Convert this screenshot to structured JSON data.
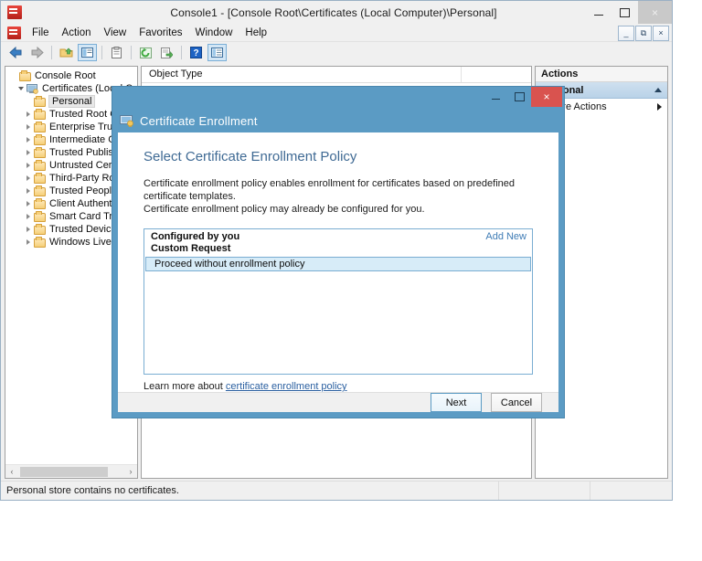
{
  "window": {
    "title": "Console1 - [Console Root\\Certificates (Local Computer)\\Personal]",
    "app_icon": "certificate-console-icon",
    "caption": {
      "minimize": "–",
      "maximize": "□",
      "close": "×"
    },
    "doc_caption": {
      "minimize": "_",
      "restore": "⧉",
      "close": "×"
    }
  },
  "menu": {
    "icon": "console-icon",
    "items": [
      {
        "label": "File"
      },
      {
        "label": "Action"
      },
      {
        "label": "View"
      },
      {
        "label": "Favorites"
      },
      {
        "label": "Window"
      },
      {
        "label": "Help"
      }
    ]
  },
  "toolbar": {
    "buttons": [
      {
        "name": "back-icon",
        "glyph": "◄"
      },
      {
        "name": "forward-icon",
        "glyph": "►"
      },
      {
        "name": "up-one-level-icon",
        "glyph": "▲"
      },
      {
        "name": "show-hide-console-tree-icon",
        "glyph": "▤",
        "pressed": true
      },
      {
        "name": "properties-icon",
        "glyph": "▯"
      },
      {
        "name": "refresh-icon",
        "glyph": "↻"
      },
      {
        "name": "export-list-icon",
        "glyph": "⇨"
      },
      {
        "name": "help-icon",
        "glyph": "?"
      },
      {
        "name": "view-icon",
        "glyph": "▥",
        "pressed": true
      }
    ]
  },
  "tree": {
    "nodes": [
      {
        "label": "Console Root",
        "indent": 0,
        "expander": "none",
        "selected": false
      },
      {
        "label": "Certificates (Local Computer",
        "indent": 1,
        "expander": "expanded",
        "selected": false
      },
      {
        "label": "Personal",
        "indent": 2,
        "expander": "none",
        "selected": true
      },
      {
        "label": "Trusted Root Cer",
        "indent": 2,
        "expander": "collapsed",
        "selected": false
      },
      {
        "label": "Enterprise Trust",
        "indent": 2,
        "expander": "collapsed",
        "selected": false
      },
      {
        "label": "Intermediate Cer",
        "indent": 2,
        "expander": "collapsed",
        "selected": false
      },
      {
        "label": "Trusted Publishe",
        "indent": 2,
        "expander": "collapsed",
        "selected": false
      },
      {
        "label": "Untrusted Certifi",
        "indent": 2,
        "expander": "collapsed",
        "selected": false
      },
      {
        "label": "Third-Party Root",
        "indent": 2,
        "expander": "collapsed",
        "selected": false
      },
      {
        "label": "Trusted People",
        "indent": 2,
        "expander": "collapsed",
        "selected": false
      },
      {
        "label": "Client Authentic",
        "indent": 2,
        "expander": "collapsed",
        "selected": false
      },
      {
        "label": "Smart Card Trust",
        "indent": 2,
        "expander": "collapsed",
        "selected": false
      },
      {
        "label": "Trusted Devices",
        "indent": 2,
        "expander": "collapsed",
        "selected": false
      },
      {
        "label": "Windows Live ID",
        "indent": 2,
        "expander": "collapsed",
        "selected": false
      }
    ],
    "hscroll": {
      "left_arrow": "‹",
      "right_arrow": "›"
    }
  },
  "list": {
    "columns": [
      {
        "label": "Object Type"
      },
      {
        "label": ""
      }
    ],
    "rows": []
  },
  "actions": {
    "header": "Actions",
    "group": {
      "label": "Personal",
      "collapse_glyph": "▲"
    },
    "items": [
      {
        "label": "More Actions",
        "submenu_glyph": "►"
      }
    ]
  },
  "status": {
    "text": "Personal store contains no certificates."
  },
  "dialog": {
    "title": "Certificate Enrollment",
    "title_icon": "certificate-enrollment-icon",
    "caption": {
      "minimize": "–",
      "maximize": "□",
      "close": "×"
    },
    "heading": "Select Certificate Enrollment Policy",
    "paragraph_line1": "Certificate enrollment policy enables enrollment for certificates based on predefined certificate templates.",
    "paragraph_line2": "Certificate enrollment policy may already be configured for you.",
    "policy_box": {
      "configured_label": "Configured by you",
      "add_new_label": "Add New",
      "custom_request_label": "Custom Request",
      "selected_item": "Proceed without enrollment policy"
    },
    "learn_more_prefix": "Learn more about ",
    "learn_more_link": "certificate enrollment policy",
    "buttons": {
      "next": "Next",
      "cancel": "Cancel"
    }
  },
  "colors": {
    "dialog_chrome": "#5b9bc4",
    "heading": "#3f6a94",
    "link": "#2a5fa0",
    "close_red": "#d9534f",
    "selection": "#d7ecf8"
  }
}
